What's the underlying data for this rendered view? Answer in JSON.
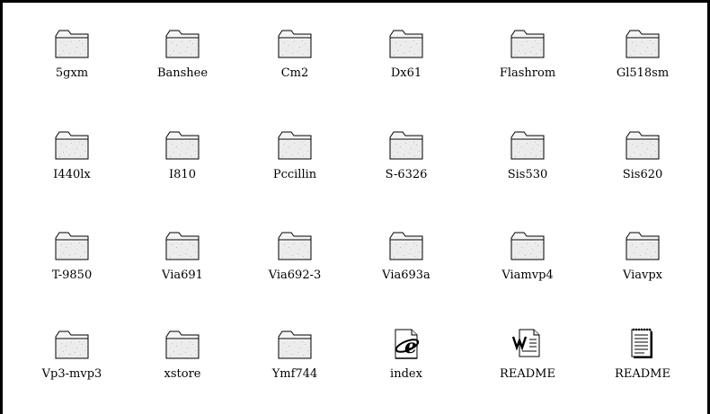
{
  "explorer": {
    "items": [
      {
        "label": "5gxm",
        "icon": "folder-icon"
      },
      {
        "label": "Banshee",
        "icon": "folder-icon"
      },
      {
        "label": "Cm2",
        "icon": "folder-icon"
      },
      {
        "label": "Dx61",
        "icon": "folder-icon"
      },
      {
        "label": "Flashrom",
        "icon": "folder-icon"
      },
      {
        "label": "Gl518sm",
        "icon": "folder-icon"
      },
      {
        "label": "I440lx",
        "icon": "folder-icon"
      },
      {
        "label": "I810",
        "icon": "folder-icon"
      },
      {
        "label": "Pccillin",
        "icon": "folder-icon"
      },
      {
        "label": "S-6326",
        "icon": "folder-icon"
      },
      {
        "label": "Sis530",
        "icon": "folder-icon"
      },
      {
        "label": "Sis620",
        "icon": "folder-icon"
      },
      {
        "label": "T-9850",
        "icon": "folder-icon"
      },
      {
        "label": "Via691",
        "icon": "folder-icon"
      },
      {
        "label": "Via692-3",
        "icon": "folder-icon"
      },
      {
        "label": "Via693a",
        "icon": "folder-icon"
      },
      {
        "label": "Viamvp4",
        "icon": "folder-icon"
      },
      {
        "label": "Viavpx",
        "icon": "folder-icon"
      },
      {
        "label": "Vp3-mvp3",
        "icon": "folder-icon"
      },
      {
        "label": "xstore",
        "icon": "folder-icon"
      },
      {
        "label": "Ymf744",
        "icon": "folder-icon"
      },
      {
        "label": "index",
        "icon": "html-document-icon"
      },
      {
        "label": "README",
        "icon": "word-document-icon"
      },
      {
        "label": "README",
        "icon": "text-document-icon"
      }
    ]
  }
}
